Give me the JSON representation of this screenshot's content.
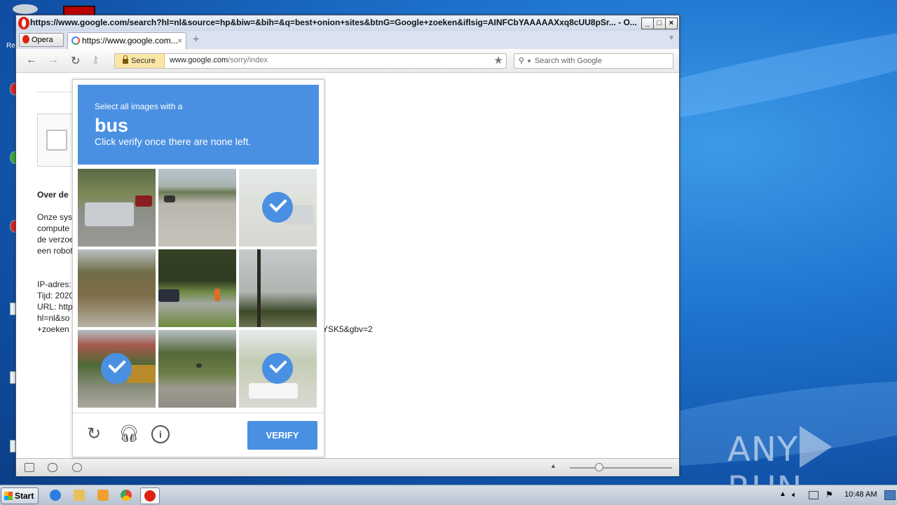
{
  "window": {
    "title": "https://www.google.com/search?hl=nl&source=hp&biw=&bih=&q=best+onion+sites&btnG=Google+zoeken&iflsig=AINFCbYAAAAAXxq8cUU8pSr... - O...",
    "minimize": "_",
    "maximize": "□",
    "close": "×"
  },
  "browser": {
    "menu_label": "Opera",
    "tab_label": "https://www.google.com...",
    "tab_close": "×",
    "new_tab": "+",
    "secure_label": "Secure",
    "url_host": "www.google.com",
    "url_path": "/sorry/index",
    "search_placeholder": "Search with Google"
  },
  "page": {
    "heading": "Over de",
    "para_lines": [
      "Onze sys",
      "compute",
      "de verzoe",
      "een robot"
    ],
    "info_lines": [
      "IP-adres:",
      "Tijd: 2020",
      "URL: http",
      "hl=nl&so",
      "+zoeken"
    ],
    "url_tail": "YSK5&gbv=2"
  },
  "captcha": {
    "line1": "Select all images with a",
    "target": "bus",
    "line3": "Click verify once there are none left.",
    "verify_label": "VERIFY",
    "tiles": [
      {
        "scene": "suv on road",
        "selected": false
      },
      {
        "scene": "highway bridge",
        "selected": false
      },
      {
        "scene": "car on road",
        "selected": true
      },
      {
        "scene": "roadside trees",
        "selected": false
      },
      {
        "scene": "car on road",
        "selected": false
      },
      {
        "scene": "palm trees",
        "selected": false
      },
      {
        "scene": "bus on road",
        "selected": true
      },
      {
        "scene": "rural road",
        "selected": false
      },
      {
        "scene": "bus on road",
        "selected": true
      }
    ]
  },
  "taskbar": {
    "start_label": "Start",
    "clock": "10:48 AM"
  },
  "watermark": "ANY RUN"
}
